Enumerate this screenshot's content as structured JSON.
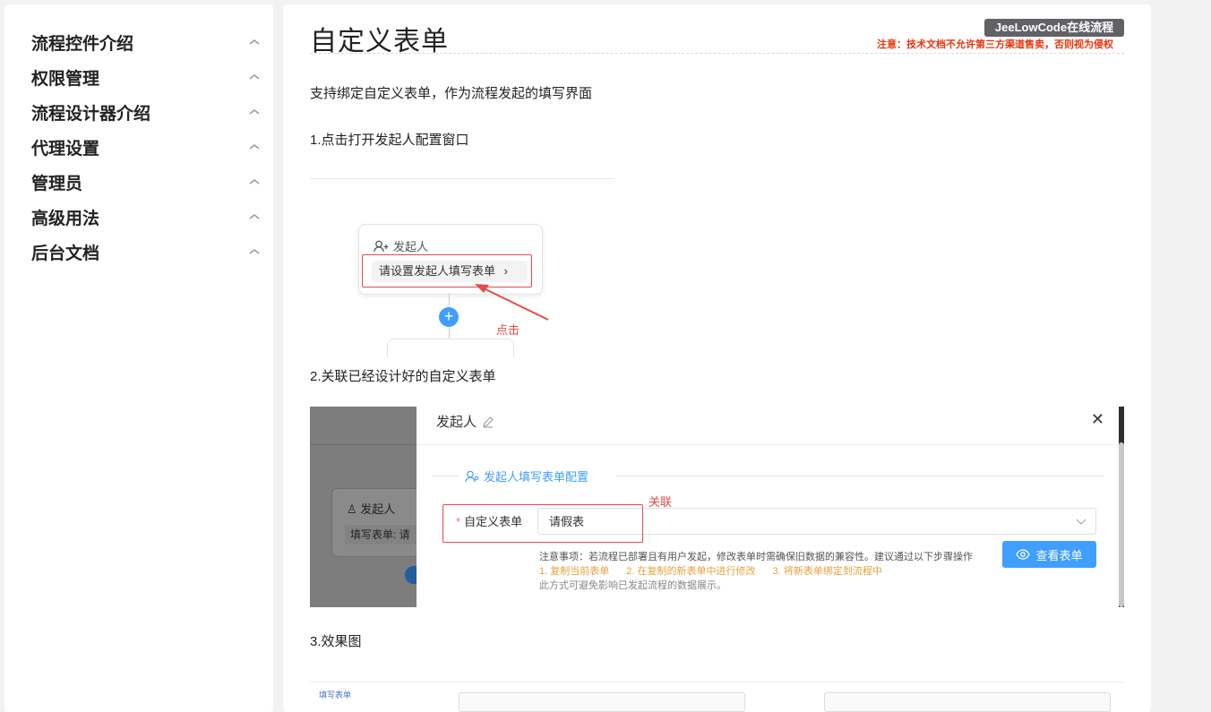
{
  "sidebar": {
    "items": [
      {
        "label": "流程控件介绍"
      },
      {
        "label": "权限管理"
      },
      {
        "label": "流程设计器介绍"
      },
      {
        "label": "代理设置"
      },
      {
        "label": "管理员"
      },
      {
        "label": "高级用法"
      },
      {
        "label": "后台文档"
      }
    ]
  },
  "main": {
    "title": "自定义表单",
    "badge": "JeeLowCode在线流程",
    "notice": "注意：技术文档不允许第三方渠道售卖，否则视为侵权",
    "intro": "支持绑定自定义表单，作为流程发起的填写界面",
    "step1": "1.点击打开发起人配置窗口",
    "step2": "2.关联已经设计好的自定义表单",
    "step3": "3.效果图"
  },
  "figure1": {
    "node_title": "发起人",
    "node_field": "请设置发起人填写表单",
    "click_label": "点击"
  },
  "figure2": {
    "bg_node_title": "发起人",
    "bg_node_field": "填写表单: 请",
    "dialog_title": "发起人",
    "section_title": "发起人填写表单配置",
    "field_label": "自定义表单",
    "field_value": "请假表",
    "annotation": "关联",
    "note_line1": "注意事项：若流程已部署且有用户发起，修改表单时需确保旧数据的兼容性。建议通过以下步骤操作",
    "note_steps": [
      "1. 复制当前表单",
      "2. 在复制的新表单中进行修改",
      "3. 将新表单绑定到流程中"
    ],
    "note_line3": "此方式可避免影响已发起流程的数据展示。",
    "view_button": "查看表单"
  },
  "figure3": {
    "label": "填写表单"
  },
  "colors": {
    "accent": "#409eff",
    "annotation_red": "#e84a4a",
    "notice_red": "#e6370f",
    "warning_orange": "#e6a23c",
    "badge_bg": "#606266"
  }
}
